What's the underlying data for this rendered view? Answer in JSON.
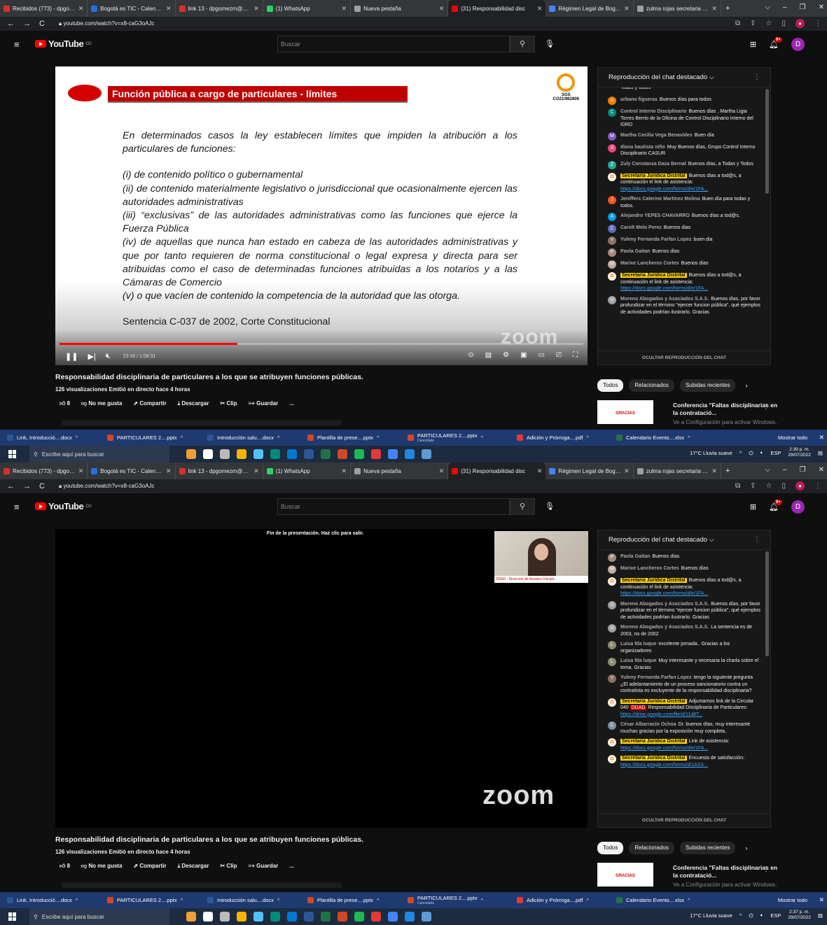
{
  "shots": [
    {
      "tabs": [
        {
          "title": "Recibidos (773) - dpgome",
          "color": "#d93025"
        },
        {
          "title": "Bogotá es TIC - Calendar",
          "color": "#1a73e8"
        },
        {
          "title": "link 13 - dpgomezm@sec",
          "color": "#d93025"
        },
        {
          "title": "(1) WhatsApp",
          "color": "#25d366"
        },
        {
          "title": "Nueva pestaña",
          "color": "#9aa0a6"
        },
        {
          "title": "(31) Responsabilidad disc",
          "color": "#ff0000"
        },
        {
          "title": "Régimen Legal de Bogotá",
          "color": "#4285f4"
        },
        {
          "title": "zulma rojas secretaria juríc",
          "color": "#9aa0a6"
        }
      ],
      "url": "youtube.com/watch?v=x8-caG3oAJc",
      "search_placeholder": "Buscar",
      "logo_text": "YouTube",
      "logo_sup": "CO",
      "notif_badge": "9+",
      "avatar_letter": "D",
      "player": {
        "time": "23:36 / 1:08:31",
        "progress": 0.34,
        "slide_title": "Función pública a cargo de particulares - límites",
        "cert_code": "CO21/962806",
        "cert_logo": "SGS",
        "slide_body": [
          "En determinados casos la ley establecen límites que impiden la atribución a los particulares  de funciones:",
          "",
          "(i) de contenido político o gubernamental",
          "(ii) de contenido materialmente legislativo o jurisdiccional que ocasionalmente ejercen las autoridades administrativas",
          "(iii) “exclusivas” de las autoridades administrativas como  las funciones que ejerce la Fuerza Pública",
          "(iv) de aquellas que nunca han estado en cabeza de las autoridades administrativas y que por tanto requieren  de norma constitucional o legal expresa y directa para ser atribuidas como el caso de determinadas funciones atribuidas a los notarios y a las Cámaras de Comercio",
          "(v) o que  vacíen de  contenido la competencia de la autoridad que las otorga."
        ],
        "slide_footer": "Sentencia C-037 de 2002, Corte Constitucional",
        "watermark": "zoom"
      },
      "chat_header": "Reproducción del chat destacado ⌵",
      "chat_footer": "OCULTAR REPRODUCCIÓN DEL CHAT",
      "chat": [
        {
          "author": "",
          "text": "Todas y todos",
          "avatar": "",
          "color": "#181818",
          "mod": false
        },
        {
          "author": "urbano figueras",
          "text": "Buenos días para todos",
          "avatar": "u",
          "color": "#f57c00",
          "mod": false
        },
        {
          "author": "Control Interno Disciplinario",
          "text": "Buenos días , Martha Ligia Torres Berrio de la Oficina de Control Disciplinario Interno del IDRD",
          "avatar": "C",
          "color": "#00897b",
          "mod": false
        },
        {
          "author": "Martha Cecilia Vega Benavides",
          "text": "Buen día",
          "avatar": "M",
          "color": "#7e57c2",
          "mod": false
        },
        {
          "author": "diana bautista niño",
          "text": "Muy Buenos días, Grupo Control Interno Disciplinario CASUR",
          "avatar": "d",
          "color": "#ec407a",
          "mod": false
        },
        {
          "author": "Zuly Constanza Daza Bernal",
          "text": "Buenos días, a Todas y Todos",
          "avatar": "Z",
          "color": "#26a69a",
          "mod": false
        },
        {
          "author": "Secretaría Jurídica Distrital",
          "text": "Buenos días a tod@s, a continuación el link de asistencia: ",
          "link": "https://docs.google.com/forms/d/e/1FA...",
          "avatar": "⚖",
          "color": "#fff3e0",
          "mod": true
        },
        {
          "author": "Jeniffers Caterine Martínez Molina",
          "text": "Buen día para todas y todos.",
          "avatar": "J",
          "color": "#f4511e",
          "mod": false
        },
        {
          "author": "Alejandro YEPES CHAVARRO",
          "text": "Buenos días a tod@s.",
          "avatar": "A",
          "color": "#039be5",
          "mod": false
        },
        {
          "author": "Carolt Melo Perez",
          "text": "Buenos dias",
          "avatar": "C",
          "color": "#5c6bc0",
          "mod": false
        },
        {
          "author": "Yuleny Fernanda Farfan Lopez",
          "text": "buen dia",
          "avatar": "Y",
          "color": "#8d6e63",
          "mod": false
        },
        {
          "author": "Paola Gaitan",
          "text": "Buenos días",
          "avatar": "P",
          "color": "#a1887f",
          "mod": false
        },
        {
          "author": "Marixe Lancheros Cortes",
          "text": "Buenos días",
          "avatar": "M",
          "color": "#bcaaa4",
          "mod": false
        },
        {
          "author": "Secretaría Jurídica Distrital",
          "text": "Buenos días a tod@s, a continuación el link de asistencia: ",
          "link": "https://docs.google.com/forms/d/e/1FA...",
          "avatar": "⚖",
          "color": "#fff3e0",
          "mod": true
        },
        {
          "author": "Moreno Abogados y Asociados S.A.S.",
          "text": "Buenos días, por favor profundizar en el término \"ejercer funcion pública\", qué ejemplos de actividades podrían ilustrarlo. Gracias",
          "avatar": "◎",
          "color": "#9e9e9e",
          "mod": false
        }
      ],
      "video_title": "Responsabilidad disciplinaria de particulares a los que se atribuyen funciones públicas.",
      "video_meta": "126 visualizaciones  Emitió en directo hace 4 horas",
      "actions": {
        "like": "8",
        "dislike": "No me gusta",
        "share": "Compartir",
        "download": "Descargar",
        "clip": "Clip",
        "save": "Guardar",
        "more": "..."
      },
      "chips": [
        "Todos",
        "Relacionados",
        "Subidas recientes"
      ],
      "rec": {
        "title": "Conferencia \"Faltas disciplinarias en la contratació...",
        "thumb": "GRACIAS",
        "activate": "Ve a Configuración para activar Windows."
      },
      "taskbar_items": [
        {
          "label": "Link, Introducció....docx",
          "color": "#2b579a"
        },
        {
          "label": "PARTICULARES 2....pptx",
          "color": "#d24726"
        },
        {
          "label": "Introducción salu....docx",
          "color": "#2b579a"
        },
        {
          "label": "Plantilla de prese....pptx",
          "color": "#d24726"
        },
        {
          "label": "PARTICULARES 2....pptx",
          "sub": "Cancelado",
          "color": "#d24726"
        },
        {
          "label": "Adición y Prórroga....pdf",
          "color": "#e53935"
        },
        {
          "label": "Calendario Evento....xlsx",
          "color": "#217346"
        }
      ],
      "show_all": "Mostrar todo",
      "win_search": "Escribe aquí para buscar",
      "weather": "17°C  Lluvia suave",
      "lang": "ESP",
      "clock_time": "2:39 p. m.",
      "clock_date": "29/07/2022"
    },
    {
      "tabs": [
        {
          "title": "Recibidos (773) - dpgome",
          "color": "#d93025"
        },
        {
          "title": "Bogotá es TIC - Calendar",
          "color": "#1a73e8"
        },
        {
          "title": "link 13 - dpgomezm@sec",
          "color": "#d93025"
        },
        {
          "title": "(1) WhatsApp",
          "color": "#25d366"
        },
        {
          "title": "Nueva pestaña",
          "color": "#9aa0a6"
        },
        {
          "title": "(31) Responsabilidad disc",
          "color": "#ff0000"
        },
        {
          "title": "Régimen Legal de Bogotá",
          "color": "#4285f4"
        },
        {
          "title": "zulma rojas secretaria juríc",
          "color": "#9aa0a6"
        }
      ],
      "url": "youtube.com/watch?v=x8-caG3oAJc",
      "search_placeholder": "Buscar",
      "logo_text": "YouTube",
      "logo_sup": "CO",
      "notif_badge": "9+",
      "avatar_letter": "D",
      "player": {
        "end_text": "Fin de la presentación. Haz clic para salir.",
        "cam_label": "DDAD - Dirección de Asuntos Discipli...",
        "watermark": "zoom"
      },
      "chat_header": "Reproducción del chat destacado ⌵",
      "chat_footer": "OCULTAR REPRODUCCIÓN DEL CHAT",
      "chat": [
        {
          "author": "Paola Gaitan",
          "text": "Buenos días",
          "avatar": "P",
          "color": "#a1887f",
          "mod": false
        },
        {
          "author": "Marixe Lancheros Cortes",
          "text": "Buenos días",
          "avatar": "M",
          "color": "#bcaaa4",
          "mod": false
        },
        {
          "author": "Secretaría Jurídica Distrital",
          "text": "Buenos días a tod@s, a continuación el link de asistencia: ",
          "link": "https://docs.google.com/forms/d/e/1FA...",
          "avatar": "⚖",
          "color": "#fff3e0",
          "mod": true
        },
        {
          "author": "Moreno Abogados y Asociados S.A.S.",
          "text": "Buenos días, por favor profundizar en el término \"ejercer funcion pública\", qué ejemplos de actividades podrían ilustrarlo. Gracias",
          "avatar": "◎",
          "color": "#9e9e9e",
          "mod": false
        },
        {
          "author": "Moreno Abogados y Asociados S.A.S.",
          "text": "La sentencia es de 2003, no de 2002",
          "avatar": "◎",
          "color": "#9e9e9e",
          "mod": false
        },
        {
          "author": "Luisa fda luque",
          "text": "excelente jornada.. Gracias a los organizadores",
          "avatar": "L",
          "color": "#8d8d6e",
          "mod": false
        },
        {
          "author": "Luisa fda luque",
          "text": "Muy interesante y necesaria la charla sobre el tema. Gracias",
          "avatar": "L",
          "color": "#8d8d6e",
          "mod": false
        },
        {
          "author": "Yuleny Fernanda Farfan Lopez",
          "text": "tengo la siguiente pregunta ¿El adelantamiento de un proceso sancionatorio contra un contratista es excluyente de la responsabilidad disciplinaria?",
          "avatar": "Y",
          "color": "#8d6e63",
          "mod": false
        },
        {
          "author": "Secretaría Jurídica Distrital",
          "text": "Adjuntamos link de la Circular 040 ",
          "tag": "DDAD",
          "text2": " Responsabilidad Disciplinaria de Particulares: ",
          "link": "https://drive.google.com/file/d/11d8T...",
          "avatar": "⚖",
          "color": "#fff3e0",
          "mod": true
        },
        {
          "author": "César Albarracín Ochoa",
          "text": "Dr. buenos días, muy interesante muchas gracias por la exposición muy completa,",
          "avatar": "C",
          "color": "#78909c",
          "mod": false
        },
        {
          "author": "Secretaría Jurídica Distrital",
          "text": "Link de asistencia: ",
          "link": "https://docs.google.com/forms/d/e/1FA...",
          "avatar": "⚖",
          "color": "#fff3e0",
          "mod": true
        },
        {
          "author": "Secretaría Jurídica Distrital",
          "text": "Encuesta de satisfacción: ",
          "link": "https://docs.google.com/forms/d/1ASS...",
          "avatar": "⚖",
          "color": "#fff3e0",
          "mod": true
        }
      ],
      "video_title": "Responsabilidad disciplinaria de particulares a los que se atribuyen funciones públicas.",
      "video_meta": "126 visualizaciones  Emitió en directo hace 4 horas",
      "actions": {
        "like": "8",
        "dislike": "No me gusta",
        "share": "Compartir",
        "download": "Descargar",
        "clip": "Clip",
        "save": "Guardar",
        "more": "..."
      },
      "chips": [
        "Todos",
        "Relacionados",
        "Subidas recientes"
      ],
      "rec": {
        "title": "Conferencia \"Faltas disciplinarias en la contratació...",
        "thumb": "GRACIAS",
        "activate": "Ve a Configuración para activar Windows."
      },
      "taskbar_items": [
        {
          "label": "Link, Introducció....docx",
          "color": "#2b579a"
        },
        {
          "label": "PARTICULARES 2....pptx",
          "color": "#d24726"
        },
        {
          "label": "Introducción salu....docx",
          "color": "#2b579a"
        },
        {
          "label": "Plantilla de prese....pptx",
          "color": "#d24726"
        },
        {
          "label": "PARTICULARES 2....pptx",
          "sub": "Cancelado",
          "color": "#d24726"
        },
        {
          "label": "Adición y Prórroga....pdf",
          "color": "#e53935"
        },
        {
          "label": "Calendario Evento....xlsx",
          "color": "#217346"
        }
      ],
      "show_all": "Mostrar todo",
      "win_search": "Escribe aquí para buscar",
      "weather": "17°C  Lluvia suave",
      "lang": "ESP",
      "clock_time": "2:37 p. m.",
      "clock_date": "29/07/2022"
    }
  ],
  "app_icon_colors": [
    "#f0a030",
    "#ffffff",
    "#bbbbbb",
    "#f4b400",
    "#4fc3f7",
    "#00897b",
    "#0078d4",
    "#2b579a",
    "#217346",
    "#d24726",
    "#1db954",
    "#e53935",
    "#4285f4",
    "#1e88e5",
    "#5c9bd5"
  ]
}
